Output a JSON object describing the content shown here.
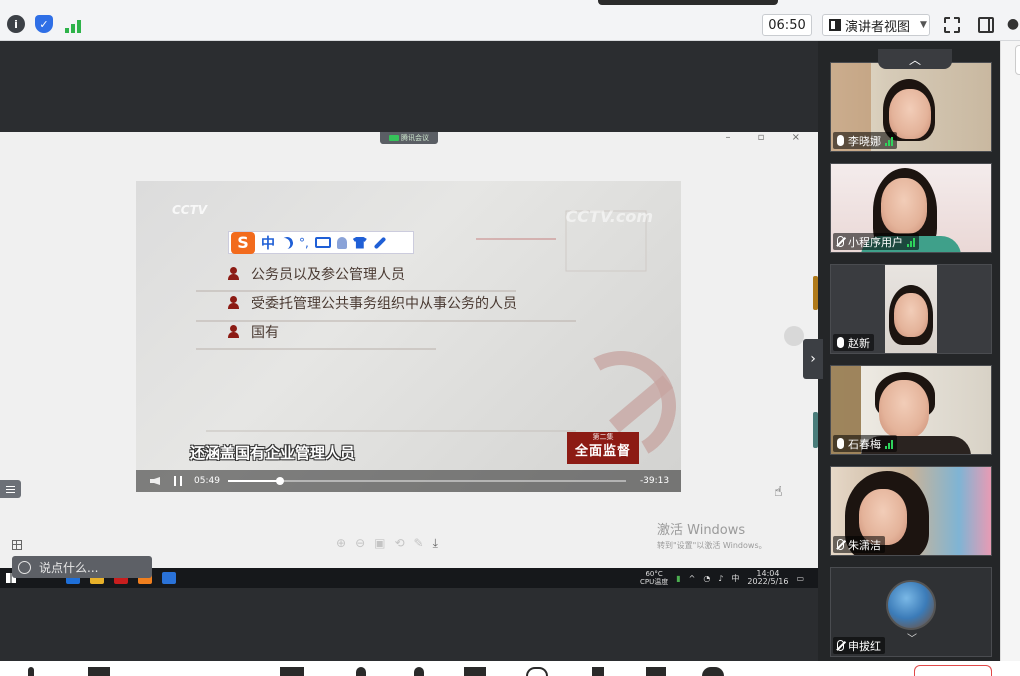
{
  "toolbar": {
    "timer": "06:50",
    "presenter_view_label": "演讲者视图",
    "icons": [
      "info-icon",
      "shield-icon",
      "signal-icon",
      "fullscreen-icon",
      "side-panel-icon",
      "user-icon"
    ]
  },
  "share": {
    "tag_label": "腾讯会议",
    "window_controls": "– ▫ ×"
  },
  "video": {
    "logo": "CCTV",
    "watermark": "CCTV.com",
    "ime": {
      "logo": "S",
      "mode": "中",
      "punct": "°,"
    },
    "bullets": [
      "公务员以及参公管理人员",
      "受委托管理公共事务组织中从事公务的人员",
      "国有"
    ],
    "subtitle": "还涵盖国有企业管理人员",
    "episode_small": "第二集",
    "episode_big": "全面监督",
    "current_time": "05:49",
    "total_time": "-39:13",
    "progress": 0.13
  },
  "watermark": {
    "line1": "激活 Windows",
    "line2": "转到\"设置\"以激活 Windows。"
  },
  "chat": {
    "placeholder": "说点什么..."
  },
  "taskbar": {
    "temp": "60°C",
    "cpu": "CPU温度",
    "ime": "中",
    "time": "14:04",
    "date": "2022/5/16"
  },
  "participants": [
    {
      "name": "李晓娜",
      "mic": "active"
    },
    {
      "name": "小程序用户",
      "mic": "active"
    },
    {
      "name": "赵新",
      "mic": "on"
    },
    {
      "name": "石春梅",
      "mic": "active"
    },
    {
      "name": "朱潇洁",
      "mic": "off"
    },
    {
      "name": "申拔红",
      "mic": "off"
    }
  ],
  "colors": {
    "accent_red": "#8c1b14",
    "mic_green": "#2fd35c",
    "end_red": "#e04848"
  }
}
